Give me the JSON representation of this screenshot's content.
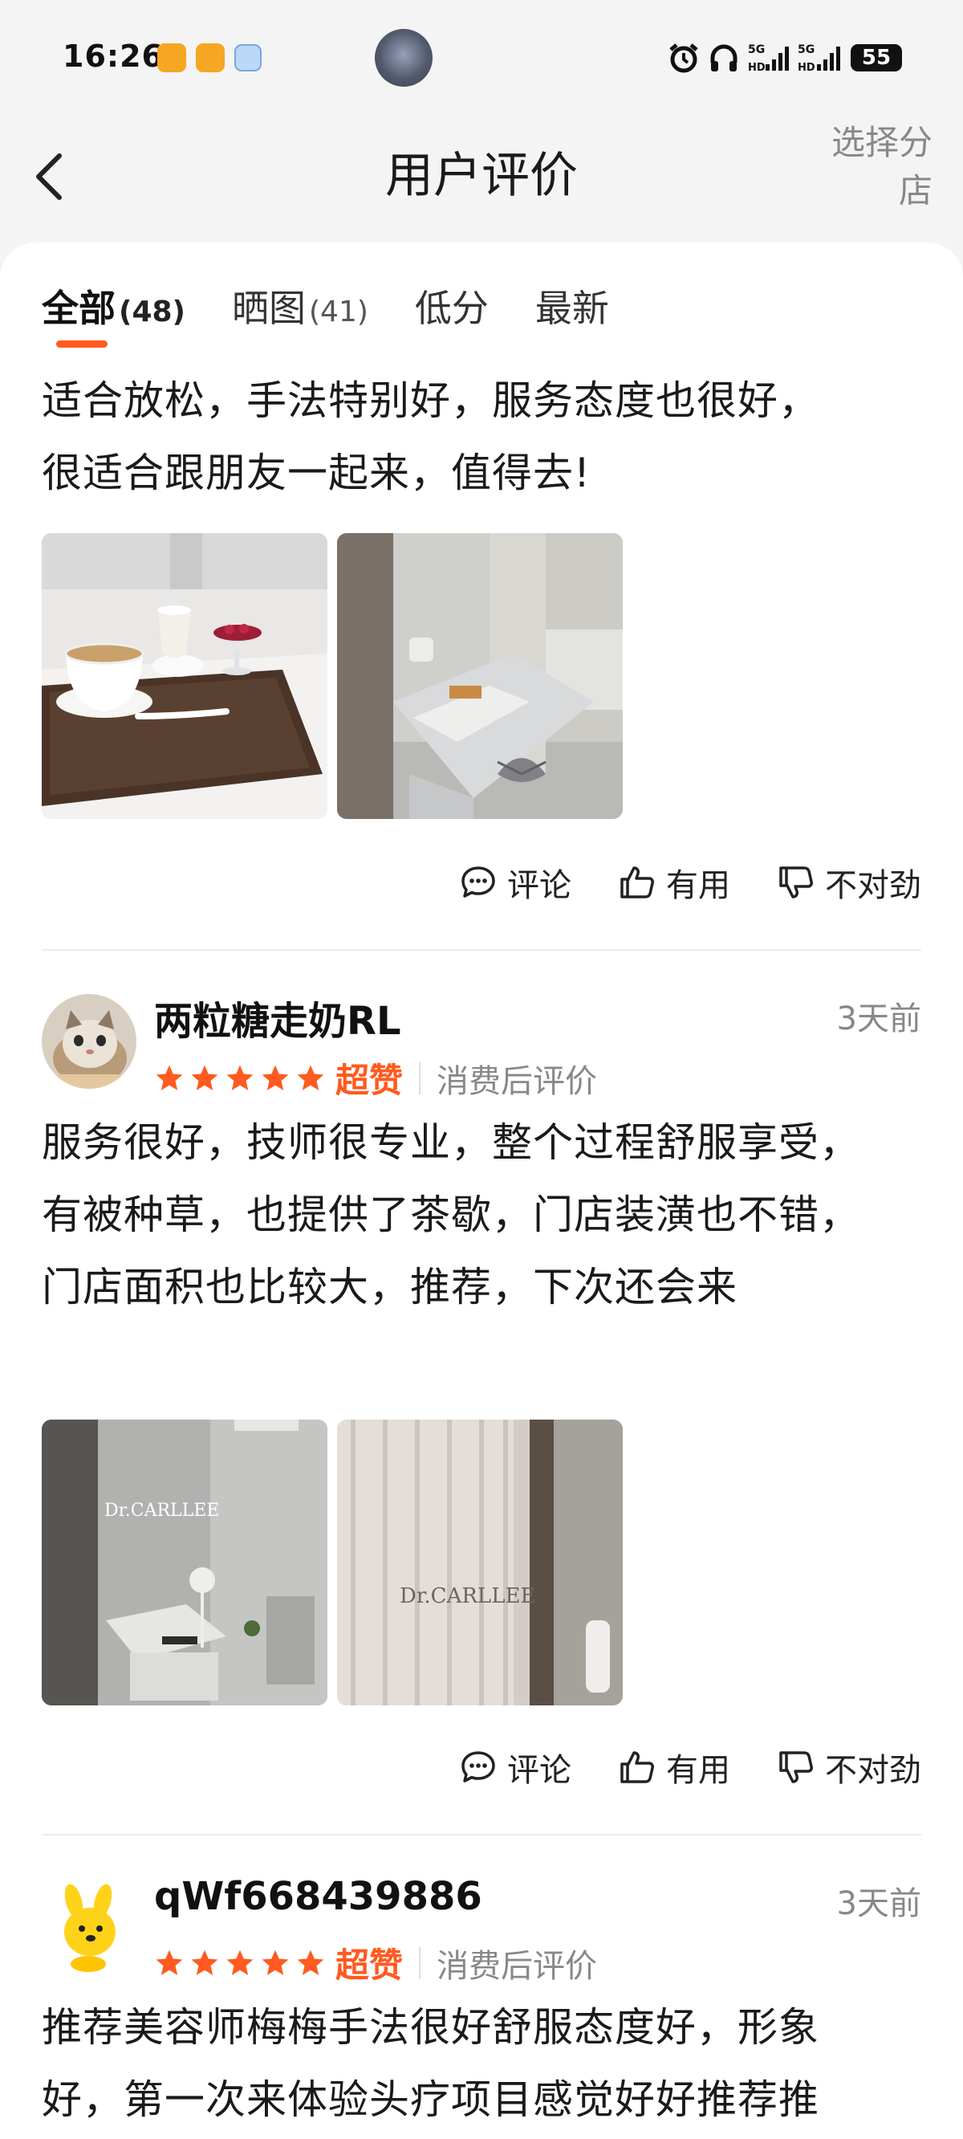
{
  "status_bar": {
    "time": "16:26",
    "battery": "55"
  },
  "header": {
    "title": "用户评价",
    "select_store_line1": "选择分",
    "select_store_line2": "店"
  },
  "tabs": [
    {
      "label": "全部",
      "count": "(48)",
      "active": true
    },
    {
      "label": "晒图",
      "count": "(41)",
      "active": false
    },
    {
      "label": "低分",
      "count": "",
      "active": false
    },
    {
      "label": "最新",
      "count": "",
      "active": false
    }
  ],
  "colors": {
    "accent": "#ff5a1f",
    "muted": "#888888"
  },
  "actions": {
    "comment": "评论",
    "useful": "有用",
    "wrong": "不对劲"
  },
  "reviews": [
    {
      "text_lines": [
        "适合放松，手法特别好，服务态度也很好，",
        "很适合跟朋友一起来，值得去!"
      ]
    },
    {
      "user": "两粒糖走奶RL",
      "time": "3天前",
      "rating_label": "超赞",
      "rating_stars": 5,
      "rating_note": "消费后评价",
      "text_lines": [
        "服务很好，技师很专业，整个过程舒服享受，",
        "有被种草，也提供了茶歇，门店装潢也不错，",
        "门店面积也比较大，推荐，下次还会来"
      ],
      "photo_brand": "Dr.CARLLEE",
      "photo_brand_2": "Dr.CARLLEE"
    },
    {
      "user": "qWf668439886",
      "time": "3天前",
      "rating_label": "超赞",
      "rating_stars": 5,
      "rating_note": "消费后评价",
      "text_lines": [
        "推荐美容师梅梅手法很好舒服态度好，形象",
        "好，第一次来体验头疗项目感觉好好推荐推"
      ]
    }
  ]
}
